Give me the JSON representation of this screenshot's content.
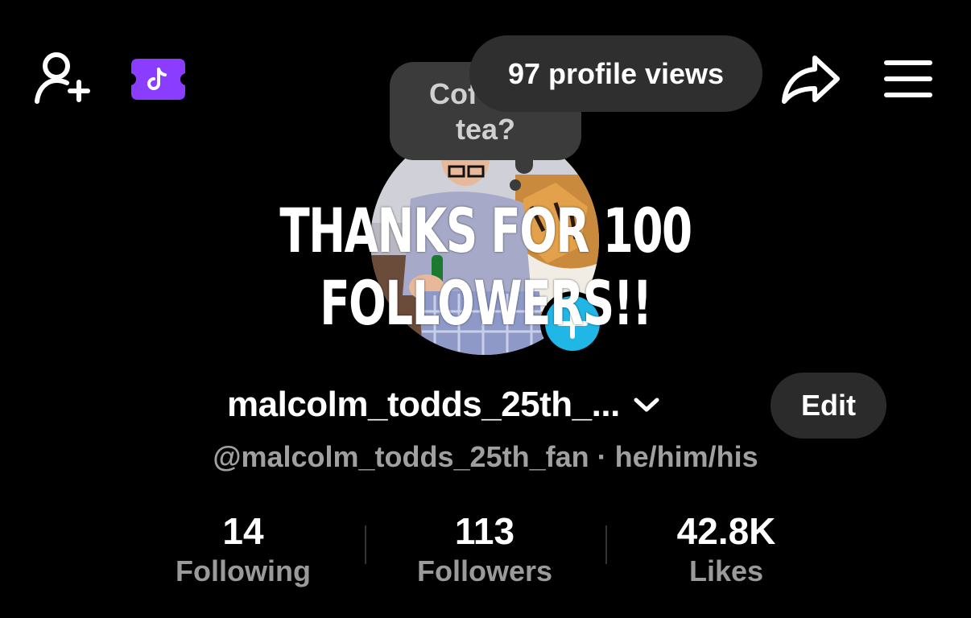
{
  "header": {
    "add_friend_icon": "person-plus-icon",
    "badge_icon": "tiktok-note-icon",
    "badge_color": "#8b3dff",
    "share_icon": "share-arrow-icon",
    "menu_icon": "hamburger-menu-icon"
  },
  "note": {
    "line1": "Cof",
    "line2": "tea?"
  },
  "profile_views": "97 profile views",
  "banner_text": "THANKS FOR 100 FOLLOWERS!!",
  "avatar": {
    "plus_badge_color": "#20b6e6"
  },
  "profile": {
    "display_name": "malcolm_todds_25th_...",
    "edit_label": "Edit",
    "handle": "@malcolm_todds_25th_fan",
    "separator": " · ",
    "pronouns": "he/him/his"
  },
  "stats": [
    {
      "value": "14",
      "label": "Following"
    },
    {
      "value": "113",
      "label": "Followers"
    },
    {
      "value": "42.8K",
      "label": "Likes"
    }
  ]
}
